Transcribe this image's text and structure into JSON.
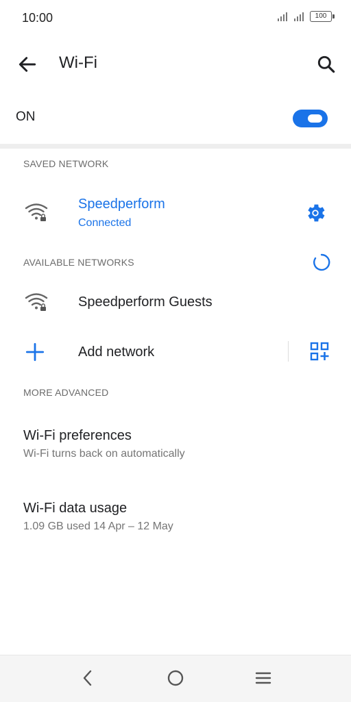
{
  "status_bar": {
    "time": "10:00",
    "battery": "100"
  },
  "app_bar": {
    "title": "Wi-Fi"
  },
  "toggle": {
    "label": "ON",
    "state": "on"
  },
  "saved_section": {
    "header": "SAVED NETWORK",
    "network": {
      "name": "Speedperform",
      "status": "Connected"
    }
  },
  "available_section": {
    "header": "AVAILABLE NETWORKS",
    "networks": [
      {
        "name": "Speedperform Guests"
      }
    ]
  },
  "add_network": {
    "label": "Add network"
  },
  "advanced_section": {
    "header": "MORE ADVANCED",
    "items": [
      {
        "title": "Wi-Fi preferences",
        "subtitle": "Wi-Fi turns back on automatically"
      },
      {
        "title": "Wi-Fi data usage",
        "subtitle": "1.09 GB used 14 Apr – 12 May"
      }
    ]
  },
  "colors": {
    "accent": "#1a73e8",
    "text": "#202124",
    "secondary_text": "#757575",
    "section_header": "#6b6b6b"
  },
  "icons": [
    "back-arrow-icon",
    "search-icon",
    "wifi-lock-icon",
    "gear-icon",
    "refresh-icon",
    "plus-icon",
    "qr-code-icon",
    "nav-back-icon",
    "nav-home-icon",
    "nav-menu-icon"
  ]
}
